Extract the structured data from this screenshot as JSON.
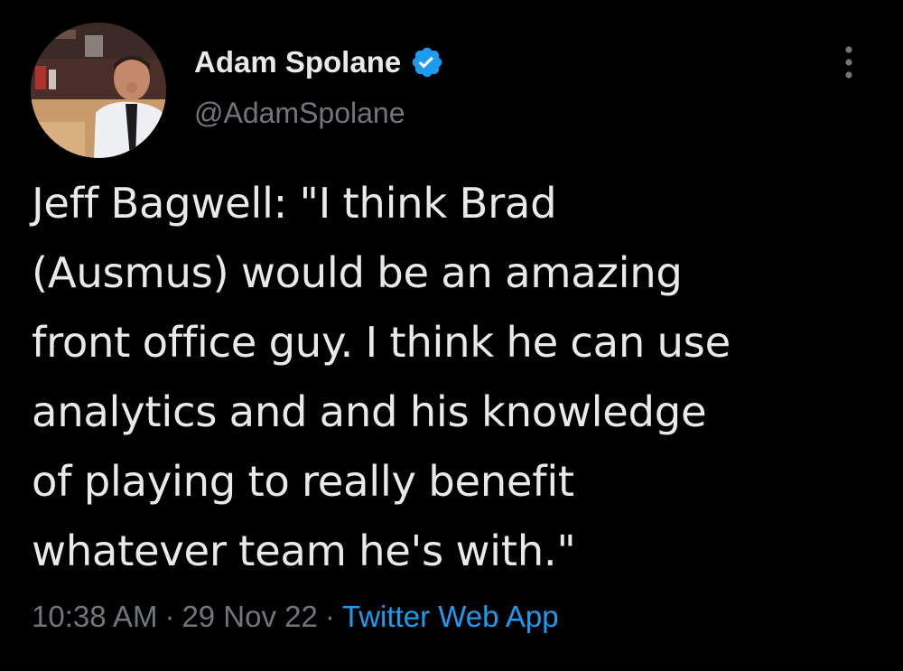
{
  "author": {
    "display_name": "Adam Spolane",
    "handle": "@AdamSpolane",
    "verified": true
  },
  "tweet": {
    "lines": [
      "Jeff Bagwell: \"I think Brad",
      "(Ausmus) would be an amazing",
      "front office guy. I think he can use",
      "analytics and and his knowledge",
      "of playing to really benefit",
      "whatever team he's with.\""
    ]
  },
  "meta": {
    "time": "10:38 AM",
    "separator": "·",
    "date": "29 Nov 22",
    "source": "Twitter Web App"
  },
  "icons": {
    "verified": "verified-badge-icon",
    "more": "more-options-icon"
  },
  "colors": {
    "background": "#000000",
    "text": "#e7e9ea",
    "secondary": "#71767b",
    "accent": "#1d9bf0"
  }
}
